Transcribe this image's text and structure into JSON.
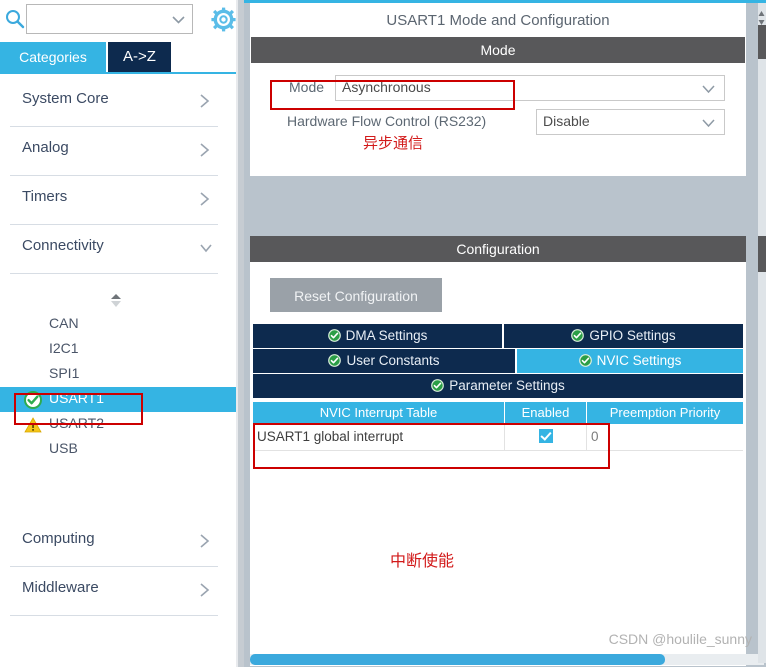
{
  "colors": {
    "accent_cyan": "#35b4e3",
    "navy": "#0d2a4e",
    "section_gray": "#58585a",
    "annotation_red": "#d21a1a",
    "panel_bg": "#b9c3cc",
    "check_green": "#2eab4f",
    "warn_yellow": "#f5c518"
  },
  "left": {
    "search": {
      "value": "",
      "placeholder": ""
    },
    "gear_tooltip": "settings",
    "tabs": [
      {
        "id": "categories",
        "label": "Categories",
        "active": true
      },
      {
        "id": "a-to-z",
        "label": "A->Z",
        "active": false
      }
    ],
    "categories_top": [
      {
        "label": "System Core",
        "expanded": false
      },
      {
        "label": "Analog",
        "expanded": false
      },
      {
        "label": "Timers",
        "expanded": false
      },
      {
        "label": "Connectivity",
        "expanded": true
      }
    ],
    "peripherals": [
      {
        "label": "CAN",
        "status": "none",
        "selected": false
      },
      {
        "label": "I2C1",
        "status": "none",
        "selected": false
      },
      {
        "label": "SPI1",
        "status": "none",
        "selected": false
      },
      {
        "label": "USART1",
        "status": "ok",
        "selected": true
      },
      {
        "label": "USART2",
        "status": "warning",
        "selected": false
      },
      {
        "label": "USB",
        "status": "none",
        "selected": false
      }
    ],
    "categories_bottom": [
      {
        "label": "Computing",
        "expanded": false
      },
      {
        "label": "Middleware",
        "expanded": false
      }
    ]
  },
  "right": {
    "panel_title": "USART1 Mode and Configuration",
    "mode_section": {
      "header": "Mode",
      "rows": [
        {
          "label": "Mode",
          "value": "Asynchronous"
        },
        {
          "label": "Hardware Flow Control (RS232)",
          "value": "Disable"
        }
      ]
    },
    "config_section": {
      "header": "Configuration",
      "reset_button": "Reset Configuration",
      "tabs": [
        {
          "label": "DMA Settings",
          "active": false,
          "checked": true
        },
        {
          "label": "GPIO Settings",
          "active": false,
          "checked": true
        },
        {
          "label": "User Constants",
          "active": false,
          "checked": true
        },
        {
          "label": "NVIC Settings",
          "active": true,
          "checked": true
        },
        {
          "label": "Parameter Settings",
          "active": false,
          "checked": true
        }
      ],
      "nvic_table": {
        "columns": [
          "NVIC Interrupt Table",
          "Enabled",
          "Preemption Priority"
        ],
        "rows": [
          {
            "name": "USART1 global interrupt",
            "enabled": true,
            "priority": "0"
          }
        ]
      }
    },
    "watermark": "CSDN @houlile_sunny"
  },
  "annotations": [
    {
      "id": "mode-note",
      "text": "异步通信"
    },
    {
      "id": "interrupt-note",
      "text": "中断使能"
    }
  ]
}
